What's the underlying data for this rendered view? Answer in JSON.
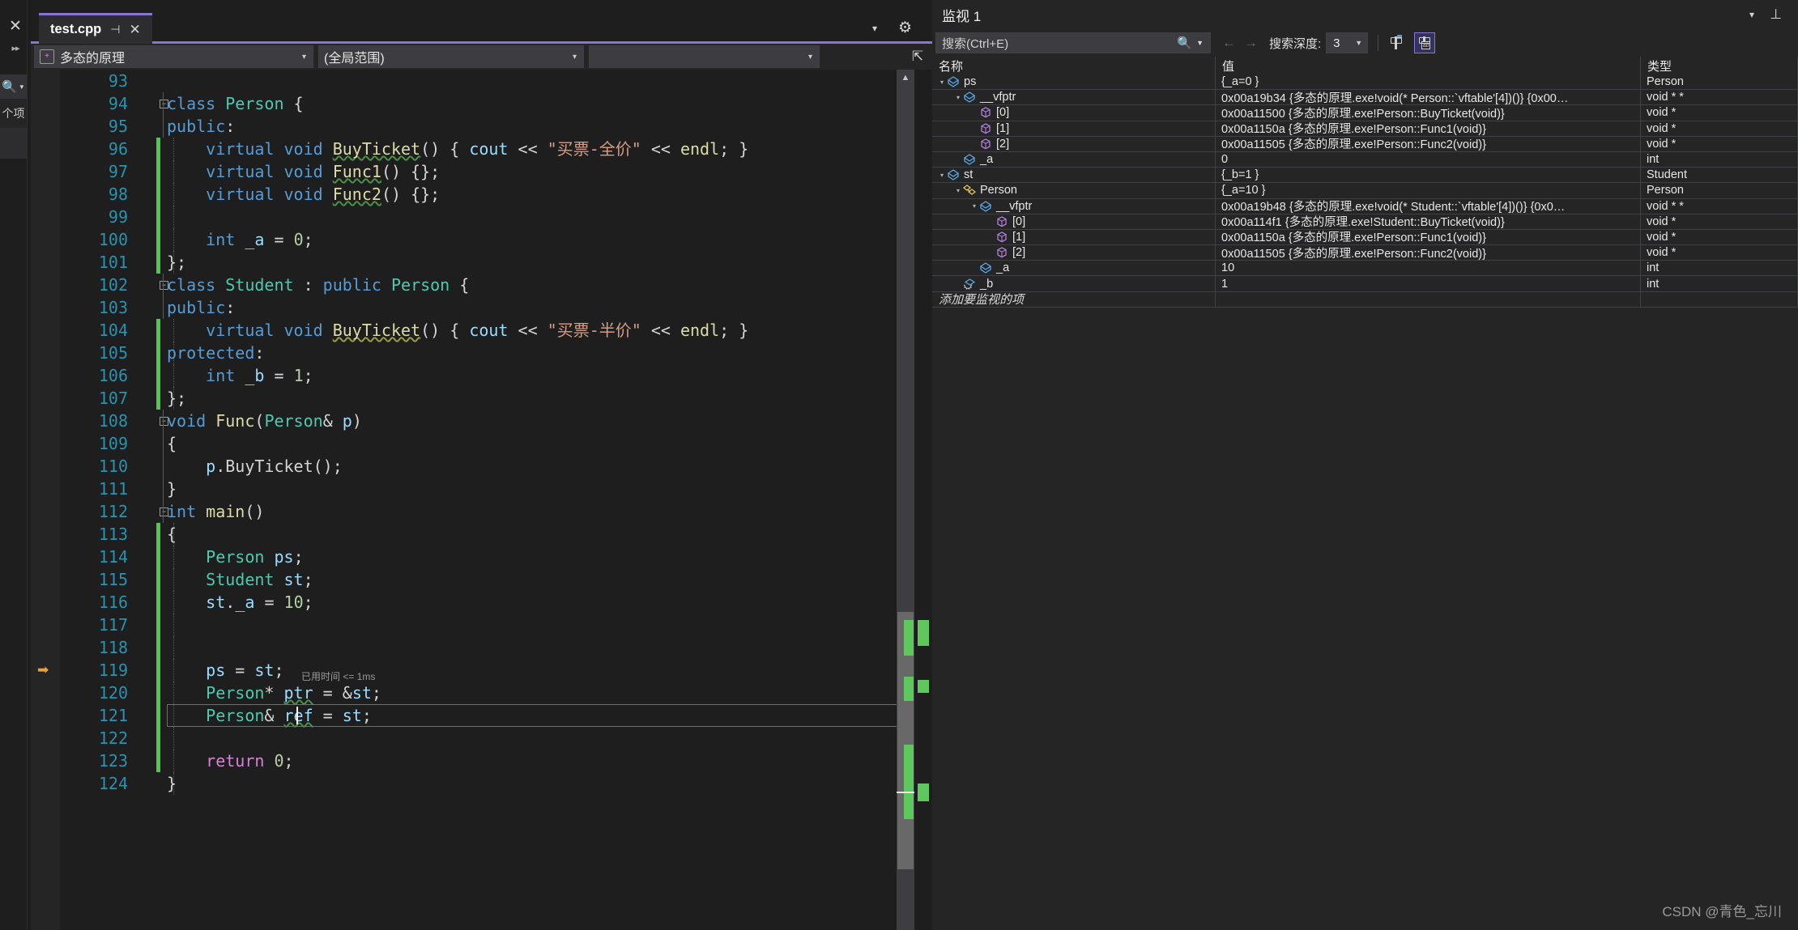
{
  "left_rail": {
    "close_icon": "✕",
    "expand_icon": "▸▸",
    "search_icon": "search-icon",
    "item_label": "个项"
  },
  "editor": {
    "tab": {
      "title": "test.cpp",
      "pin_icon": "⊣",
      "close_icon": "✕"
    },
    "tabstrip": {
      "caret": "▾",
      "gear": "⚙"
    },
    "navbar": {
      "project_dropdown": "多态的原理",
      "scope_dropdown": "(全局范围)",
      "member_dropdown": "",
      "caret": "▾",
      "split_icon": "⇱"
    },
    "accent_color": "#8b74d8",
    "time_tip": "已用时间 <= 1ms",
    "current_line": 121,
    "exec_line": 119,
    "lines": [
      {
        "n": 93,
        "tokens": []
      },
      {
        "n": 94,
        "fold": true,
        "tokens": [
          {
            "t": "class ",
            "c": "k"
          },
          {
            "t": "Person",
            "c": "ty"
          },
          {
            "t": " {",
            "c": "pn"
          }
        ]
      },
      {
        "n": 95,
        "tokens": [
          {
            "t": "public",
            "c": "k"
          },
          {
            "t": ":",
            "c": "pn"
          }
        ]
      },
      {
        "n": 96,
        "chg": true,
        "tokens": [
          {
            "t": "    ",
            "c": "pn"
          },
          {
            "t": "virtual ",
            "c": "k"
          },
          {
            "t": "void ",
            "c": "k"
          },
          {
            "t": "BuyTicket",
            "c": "fn squig"
          },
          {
            "t": "() { ",
            "c": "pn"
          },
          {
            "t": "cout",
            "c": "id"
          },
          {
            "t": " << ",
            "c": "pn"
          },
          {
            "t": "\"买票-全价\"",
            "c": "st"
          },
          {
            "t": " << ",
            "c": "pn"
          },
          {
            "t": "endl",
            "c": "fn"
          },
          {
            "t": "; }",
            "c": "pn"
          }
        ]
      },
      {
        "n": 97,
        "chg": true,
        "tokens": [
          {
            "t": "    ",
            "c": "pn"
          },
          {
            "t": "virtual ",
            "c": "k"
          },
          {
            "t": "void ",
            "c": "k"
          },
          {
            "t": "Func1",
            "c": "fn squig"
          },
          {
            "t": "() {};",
            "c": "pn"
          }
        ]
      },
      {
        "n": 98,
        "chg": true,
        "tokens": [
          {
            "t": "    ",
            "c": "pn"
          },
          {
            "t": "virtual ",
            "c": "k"
          },
          {
            "t": "void ",
            "c": "k"
          },
          {
            "t": "Func2",
            "c": "fn squig"
          },
          {
            "t": "() {};",
            "c": "pn"
          }
        ]
      },
      {
        "n": 99,
        "chg": true,
        "tokens": []
      },
      {
        "n": 100,
        "chg": true,
        "tokens": [
          {
            "t": "    ",
            "c": "pn"
          },
          {
            "t": "int ",
            "c": "k"
          },
          {
            "t": "_a",
            "c": "id"
          },
          {
            "t": " = ",
            "c": "pn"
          },
          {
            "t": "0",
            "c": "nm"
          },
          {
            "t": ";",
            "c": "pn"
          }
        ]
      },
      {
        "n": 101,
        "chg": true,
        "tokens": [
          {
            "t": "};",
            "c": "pn"
          }
        ]
      },
      {
        "n": 102,
        "fold": true,
        "tokens": [
          {
            "t": "class ",
            "c": "k"
          },
          {
            "t": "Student",
            "c": "ty"
          },
          {
            "t": " : ",
            "c": "pn"
          },
          {
            "t": "public ",
            "c": "k"
          },
          {
            "t": "Person",
            "c": "ty"
          },
          {
            "t": " {",
            "c": "pn"
          }
        ]
      },
      {
        "n": 103,
        "tokens": [
          {
            "t": "public",
            "c": "k"
          },
          {
            "t": ":",
            "c": "pn"
          }
        ]
      },
      {
        "n": 104,
        "chg": true,
        "tokens": [
          {
            "t": "    ",
            "c": "pn"
          },
          {
            "t": "virtual ",
            "c": "k"
          },
          {
            "t": "void ",
            "c": "k"
          },
          {
            "t": "BuyTicket",
            "c": "fn squigy"
          },
          {
            "t": "() { ",
            "c": "pn"
          },
          {
            "t": "cout",
            "c": "id"
          },
          {
            "t": " << ",
            "c": "pn"
          },
          {
            "t": "\"买票-半价\"",
            "c": "st"
          },
          {
            "t": " << ",
            "c": "pn"
          },
          {
            "t": "endl",
            "c": "fn"
          },
          {
            "t": "; }",
            "c": "pn"
          }
        ]
      },
      {
        "n": 105,
        "chg": true,
        "tokens": [
          {
            "t": "protected",
            "c": "k"
          },
          {
            "t": ":",
            "c": "pn"
          }
        ]
      },
      {
        "n": 106,
        "chg": true,
        "tokens": [
          {
            "t": "    ",
            "c": "pn"
          },
          {
            "t": "int ",
            "c": "k"
          },
          {
            "t": "_b",
            "c": "id"
          },
          {
            "t": " = ",
            "c": "pn"
          },
          {
            "t": "1",
            "c": "nm"
          },
          {
            "t": ";",
            "c": "pn"
          }
        ]
      },
      {
        "n": 107,
        "chg": true,
        "tokens": [
          {
            "t": "};",
            "c": "pn"
          }
        ]
      },
      {
        "n": 108,
        "fold": true,
        "tokens": [
          {
            "t": "void ",
            "c": "k"
          },
          {
            "t": "Func",
            "c": "fn"
          },
          {
            "t": "(",
            "c": "pn"
          },
          {
            "t": "Person",
            "c": "ty"
          },
          {
            "t": "& ",
            "c": "pn"
          },
          {
            "t": "p",
            "c": "id"
          },
          {
            "t": ")",
            "c": "pn"
          }
        ]
      },
      {
        "n": 109,
        "tokens": [
          {
            "t": "{",
            "c": "pn"
          }
        ]
      },
      {
        "n": 110,
        "tokens": [
          {
            "t": "    ",
            "c": "pn"
          },
          {
            "t": "p",
            "c": "id"
          },
          {
            "t": ".",
            "c": "pn"
          },
          {
            "t": "BuyTicket",
            "c": "pn"
          },
          {
            "t": "();",
            "c": "pn"
          }
        ]
      },
      {
        "n": 111,
        "tokens": [
          {
            "t": "}",
            "c": "pn"
          }
        ]
      },
      {
        "n": 112,
        "fold": true,
        "tokens": [
          {
            "t": "int ",
            "c": "k"
          },
          {
            "t": "main",
            "c": "fn"
          },
          {
            "t": "()",
            "c": "pn"
          }
        ]
      },
      {
        "n": 113,
        "chg": true,
        "tokens": [
          {
            "t": "{",
            "c": "pn"
          }
        ]
      },
      {
        "n": 114,
        "chg": true,
        "tokens": [
          {
            "t": "    ",
            "c": "pn"
          },
          {
            "t": "Person",
            "c": "ty"
          },
          {
            "t": " ",
            "c": "pn"
          },
          {
            "t": "ps",
            "c": "id"
          },
          {
            "t": ";",
            "c": "pn"
          }
        ]
      },
      {
        "n": 115,
        "chg": true,
        "tokens": [
          {
            "t": "    ",
            "c": "pn"
          },
          {
            "t": "Student",
            "c": "ty"
          },
          {
            "t": " ",
            "c": "pn"
          },
          {
            "t": "st",
            "c": "id"
          },
          {
            "t": ";",
            "c": "pn"
          }
        ]
      },
      {
        "n": 116,
        "chg": true,
        "tokens": [
          {
            "t": "    ",
            "c": "pn"
          },
          {
            "t": "st",
            "c": "id"
          },
          {
            "t": ".",
            "c": "pn"
          },
          {
            "t": "_a",
            "c": "id"
          },
          {
            "t": " = ",
            "c": "pn"
          },
          {
            "t": "10",
            "c": "nm"
          },
          {
            "t": ";",
            "c": "pn"
          }
        ]
      },
      {
        "n": 117,
        "chg": true,
        "tokens": []
      },
      {
        "n": 118,
        "chg": true,
        "tokens": []
      },
      {
        "n": 119,
        "chg": true,
        "tokens": [
          {
            "t": "    ",
            "c": "pn"
          },
          {
            "t": "ps",
            "c": "id"
          },
          {
            "t": " = ",
            "c": "pn"
          },
          {
            "t": "st",
            "c": "id"
          },
          {
            "t": ";",
            "c": "pn"
          }
        ]
      },
      {
        "n": 120,
        "chg": true,
        "tokens": [
          {
            "t": "    ",
            "c": "pn"
          },
          {
            "t": "Person",
            "c": "ty"
          },
          {
            "t": "* ",
            "c": "pn"
          },
          {
            "t": "ptr",
            "c": "id squig"
          },
          {
            "t": " = &",
            "c": "pn"
          },
          {
            "t": "st",
            "c": "id"
          },
          {
            "t": ";",
            "c": "pn"
          }
        ]
      },
      {
        "n": 121,
        "chg": true,
        "tokens": [
          {
            "t": "    ",
            "c": "pn"
          },
          {
            "t": "Person",
            "c": "ty"
          },
          {
            "t": "& ",
            "c": "pn"
          },
          {
            "t": "ref",
            "c": "id squig"
          },
          {
            "t": " = ",
            "c": "pn"
          },
          {
            "t": "st",
            "c": "id"
          },
          {
            "t": ";",
            "c": "pn"
          }
        ]
      },
      {
        "n": 122,
        "chg": true,
        "tokens": []
      },
      {
        "n": 123,
        "chg": true,
        "tokens": [
          {
            "t": "    ",
            "c": "pn"
          },
          {
            "t": "return ",
            "c": "kp"
          },
          {
            "t": "0",
            "c": "nm"
          },
          {
            "t": ";",
            "c": "pn"
          }
        ]
      },
      {
        "n": 124,
        "tokens": [
          {
            "t": "}",
            "c": "pn"
          }
        ]
      }
    ]
  },
  "watch": {
    "title": "监视 1",
    "caret_icon": "▾",
    "pin_icon": "⊥",
    "search_placeholder": "搜索(Ctrl+E)",
    "search_icon": "search-icon",
    "nav_back_icon": "←",
    "nav_forward_icon": "→",
    "depth_label": "搜索深度:",
    "depth_value": "3",
    "pin_button_icon": "pin-icon",
    "hex_button_icon": "pin-db-icon",
    "columns": [
      "名称",
      "值",
      "类型"
    ],
    "add_row": "添加要监视的项",
    "rows": [
      {
        "depth": 0,
        "tri": "▾",
        "icon": "field",
        "name": "ps",
        "value": "{_a=0 }",
        "type": "Person"
      },
      {
        "depth": 1,
        "tri": "▾",
        "icon": "field",
        "name": "__vfptr",
        "value": "0x00a19b34 {多态的原理.exe!void(* Person::`vftable'[4])()} {0x00…",
        "type": "void * *"
      },
      {
        "depth": 2,
        "tri": "",
        "icon": "elem",
        "name": "[0]",
        "value": "0x00a11500 {多态的原理.exe!Person::BuyTicket(void)}",
        "type": "void *"
      },
      {
        "depth": 2,
        "tri": "",
        "icon": "elem",
        "name": "[1]",
        "value": "0x00a1150a {多态的原理.exe!Person::Func1(void)}",
        "type": "void *"
      },
      {
        "depth": 2,
        "tri": "",
        "icon": "elem",
        "name": "[2]",
        "value": "0x00a11505 {多态的原理.exe!Person::Func2(void)}",
        "type": "void *"
      },
      {
        "depth": 1,
        "tri": "",
        "icon": "field",
        "name": "_a",
        "value": "0",
        "type": "int"
      },
      {
        "depth": 0,
        "tri": "▾",
        "icon": "field",
        "name": "st",
        "value": "{_b=1 }",
        "type": "Student"
      },
      {
        "depth": 1,
        "tri": "▾",
        "icon": "base",
        "name": "Person",
        "value": "{_a=10 }",
        "type": "Person"
      },
      {
        "depth": 2,
        "tri": "▾",
        "icon": "field",
        "name": "__vfptr",
        "value": "0x00a19b48 {多态的原理.exe!void(* Student::`vftable'[4])()} {0x0…",
        "type": "void * *"
      },
      {
        "depth": 3,
        "tri": "",
        "icon": "elem",
        "name": "[0]",
        "value": "0x00a114f1 {多态的原理.exe!Student::BuyTicket(void)}",
        "type": "void *"
      },
      {
        "depth": 3,
        "tri": "",
        "icon": "elem",
        "name": "[1]",
        "value": "0x00a1150a {多态的原理.exe!Person::Func1(void)}",
        "type": "void *"
      },
      {
        "depth": 3,
        "tri": "",
        "icon": "elem",
        "name": "[2]",
        "value": "0x00a11505 {多态的原理.exe!Person::Func2(void)}",
        "type": "void *"
      },
      {
        "depth": 2,
        "tri": "",
        "icon": "field",
        "name": "_a",
        "value": "10",
        "type": "int"
      },
      {
        "depth": 1,
        "tri": "",
        "icon": "prot",
        "name": "_b",
        "value": "1",
        "type": "int"
      }
    ]
  },
  "watermark": "CSDN @青色_忘川"
}
